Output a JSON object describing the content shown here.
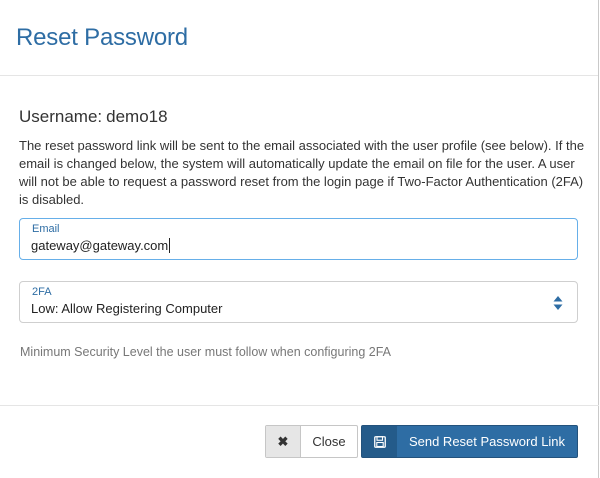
{
  "modal": {
    "title": "Reset Password"
  },
  "user": {
    "username_label": "Username:",
    "username_value": "demo18"
  },
  "description": "The reset password link will be sent to the email associated with the user profile (see below). If the email is changed below, the system will automatically update the email on file for the user. A user will not be able to request a password reset from the login page if Two-Factor Authentication (2FA) is disabled.",
  "email_field": {
    "label": "Email",
    "value": "gateway@gateway.com"
  },
  "twofa_field": {
    "label": "2FA",
    "selected": "Low: Allow Registering Computer",
    "icon": "select-arrows-icon"
  },
  "help_text": "Minimum Security Level the user must follow when configuring 2FA",
  "footer": {
    "close_label": "Close",
    "close_icon": "close-icon",
    "send_label": "Send Reset Password Link",
    "send_icon": "save-icon"
  },
  "colors": {
    "accent": "#2e6da4",
    "focus_border": "#66afe9",
    "help_text": "#777777"
  }
}
